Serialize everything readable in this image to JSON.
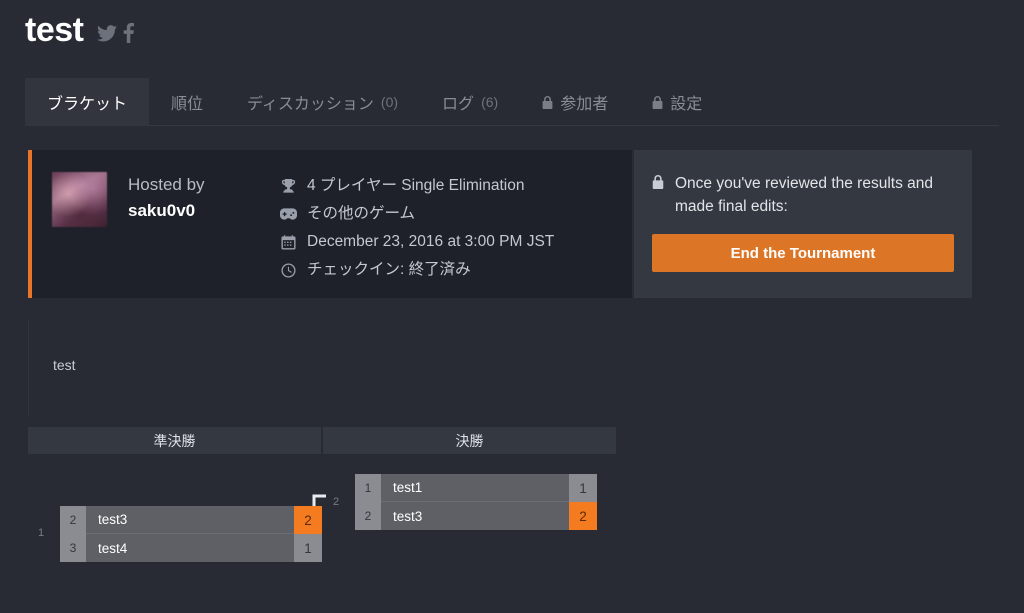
{
  "header": {
    "title": "test",
    "social": [
      {
        "name": "twitter-icon",
        "label": "Twitter"
      },
      {
        "name": "facebook-icon",
        "label": "Facebook"
      }
    ]
  },
  "tabs": [
    {
      "label": "ブラケット",
      "count": "",
      "locked": false,
      "active": true
    },
    {
      "label": "順位",
      "count": "",
      "locked": false,
      "active": false
    },
    {
      "label": "ディスカッション",
      "count": "(0)",
      "locked": false,
      "active": false
    },
    {
      "label": "ログ",
      "count": "(6)",
      "locked": false,
      "active": false
    },
    {
      "label": "参加者",
      "count": "",
      "locked": true,
      "active": false
    },
    {
      "label": "設定",
      "count": "",
      "locked": true,
      "active": false
    }
  ],
  "info": {
    "hosted_by_label": "Hosted by",
    "host_name": "saku0v0",
    "meta": [
      {
        "icon": "trophy-icon",
        "text": "4 プレイヤー Single Elimination"
      },
      {
        "icon": "gamepad-icon",
        "text": "その他のゲーム"
      },
      {
        "icon": "calendar-icon",
        "text": "December 23, 2016 at 3:00 PM JST"
      },
      {
        "icon": "clock-icon",
        "text": "チェックイン: 終了済み"
      }
    ]
  },
  "action": {
    "lock_icon": "lock-icon",
    "message": "Once you've reviewed the results and made final edits:",
    "button_label": "End the Tournament",
    "button_color": "#dd7527"
  },
  "bracket": {
    "group_name": "test",
    "rounds": [
      {
        "label": "準決勝"
      },
      {
        "label": "決勝"
      }
    ],
    "matches": [
      {
        "number": "1",
        "round": 1,
        "players": [
          {
            "seed": "2",
            "name": "test3",
            "score": "2",
            "winner": true
          },
          {
            "seed": "3",
            "name": "test4",
            "score": "1",
            "winner": false
          }
        ]
      },
      {
        "number": "2",
        "round": 2,
        "players": [
          {
            "seed": "1",
            "name": "test1",
            "score": "1",
            "winner": false
          },
          {
            "seed": "2",
            "name": "test3",
            "score": "2",
            "winner": true
          }
        ]
      }
    ]
  },
  "colors": {
    "page_bg": "#282b33",
    "panel_bg": "#1e2129",
    "panel_alt_bg": "#343841",
    "accent": "#e8752a",
    "winner": "#f47b20"
  }
}
